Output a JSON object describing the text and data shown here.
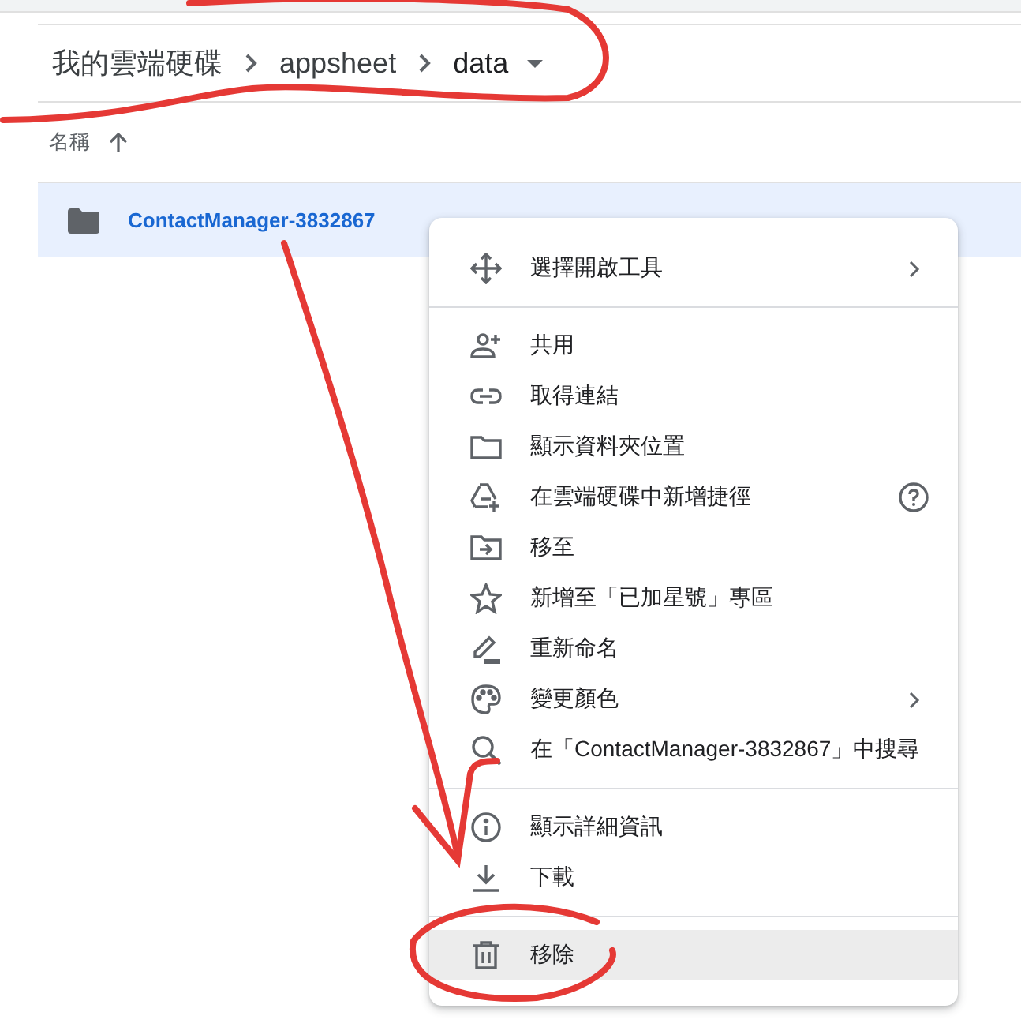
{
  "breadcrumb": [
    {
      "label": "我的雲端硬碟",
      "dropdown": false
    },
    {
      "label": "appsheet",
      "dropdown": false
    },
    {
      "label": "data",
      "dropdown": true
    }
  ],
  "sort_header": {
    "label": "名稱"
  },
  "files": [
    {
      "name": "ContactManager-3832867",
      "selected": true
    }
  ],
  "context_menu": {
    "groups": [
      {
        "items": [
          {
            "label": "選擇開啟工具",
            "submenu": true,
            "help": false,
            "selected": false
          }
        ]
      },
      {
        "items": [
          {
            "label": "共用",
            "submenu": false,
            "help": false,
            "selected": false
          },
          {
            "label": "取得連結",
            "submenu": false,
            "help": false,
            "selected": false
          },
          {
            "label": "顯示資料夾位置",
            "submenu": false,
            "help": false,
            "selected": false
          },
          {
            "label": "在雲端硬碟中新增捷徑",
            "submenu": false,
            "help": true,
            "selected": false
          },
          {
            "label": "移至",
            "submenu": false,
            "help": false,
            "selected": false
          },
          {
            "label": "新增至「已加星號」專區",
            "submenu": false,
            "help": false,
            "selected": false
          },
          {
            "label": "重新命名",
            "submenu": false,
            "help": false,
            "selected": false
          },
          {
            "label": "變更顏色",
            "submenu": true,
            "help": false,
            "selected": false
          },
          {
            "label": "在「ContactManager-3832867」中搜尋",
            "submenu": false,
            "help": false,
            "selected": false
          }
        ]
      },
      {
        "items": [
          {
            "label": "顯示詳細資訊",
            "submenu": false,
            "help": false,
            "selected": false
          },
          {
            "label": "下載",
            "submenu": false,
            "help": false,
            "selected": false
          }
        ]
      },
      {
        "items": [
          {
            "label": "移除",
            "submenu": false,
            "help": false,
            "selected": true
          }
        ]
      }
    ]
  }
}
